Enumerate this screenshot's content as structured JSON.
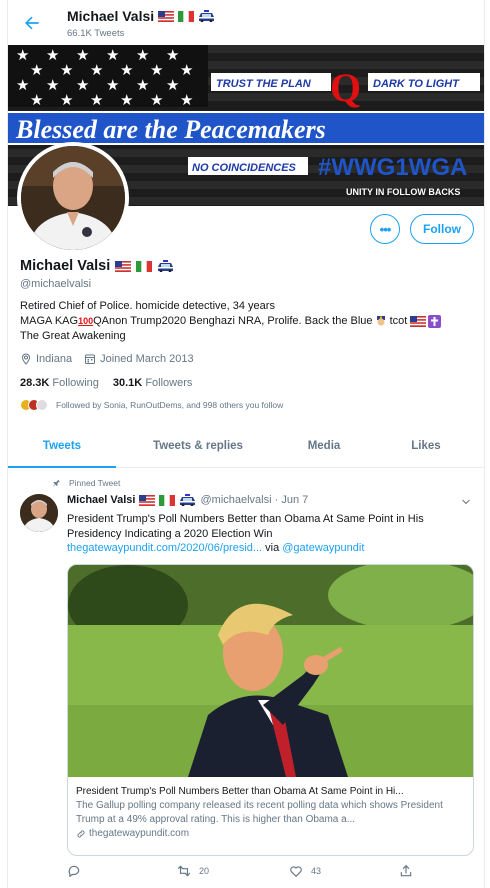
{
  "header": {
    "name": "Michael Valsi",
    "tweet_count": "66.1K Tweets"
  },
  "banner": {
    "trust_text": "TRUST THE PLAN",
    "q_letter": "Q",
    "dark_text": "DARK TO LIGHT",
    "blessed_text": "Blessed are the Peacemakers",
    "no_coincidences": "NO COINCIDENCES",
    "hashtag": "#WWG1WGA",
    "unity": "UNITY IN FOLLOW BACKS"
  },
  "profile": {
    "name": "Michael Valsi",
    "handle": "@michaelvalsi",
    "bio_line1": "Retired Chief of Police. homicide detective, 34 years",
    "bio_line2a": "MAGA KAG",
    "bio_line2b": "QAnon Trump2020 Benghazi NRA, Prolife. Back the Blue",
    "bio_line2c": " tcot ",
    "bio_line3": "The Great Awakening",
    "location": "Indiana",
    "joined": "Joined March 2013",
    "following_count": "28.3K",
    "following_label": "Following",
    "followers_count": "30.1K",
    "followers_label": "Followers",
    "followed_by": "Followed by Sonia, RunOutDems, and 998 others you follow"
  },
  "buttons": {
    "more": "•••",
    "follow": "Follow"
  },
  "tabs": [
    "Tweets",
    "Tweets & replies",
    "Media",
    "Likes"
  ],
  "tweet": {
    "pinned": "Pinned Tweet",
    "name": "Michael Valsi",
    "handle_date": "@michaelvalsi · Jun 7",
    "text": "President Trump's Poll Numbers Better than Obama At Same Point in His Presidency Indicating a 2020 Election Win",
    "link": "thegatewaypundit.com/2020/06/presid...",
    "via": " via ",
    "via_handle": "@gatewaypundit",
    "card_title": "President Trump's Poll Numbers Better than Obama At Same Point in Hi...",
    "card_desc": "The Gallup polling company released its recent polling data which shows President Trump at a 49% approval rating.  This is higher than Obama a...",
    "card_domain": "thegatewaypundit.com",
    "retweets": "20",
    "likes": "43"
  },
  "colors": {
    "accent": "#1da1f2",
    "text": "#14171a",
    "muted": "#657786",
    "border": "#e6ecf0"
  }
}
